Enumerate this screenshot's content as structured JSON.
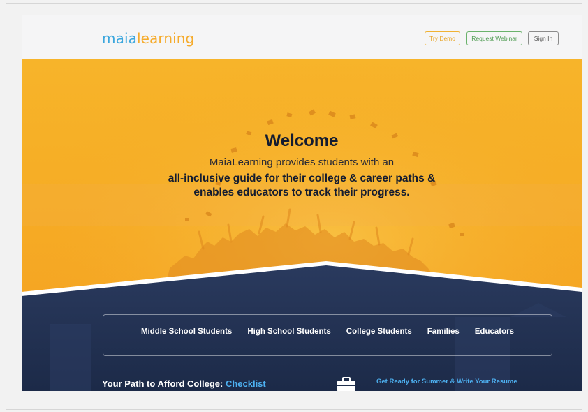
{
  "brand": {
    "logo_part1": "maia",
    "logo_part2": "learning"
  },
  "header": {
    "try_demo": "Try Demo",
    "request_webinar": "Request Webinar",
    "sign_in": "Sign In"
  },
  "hero": {
    "title": "Welcome",
    "line1": "MaiaLearning provides students with an",
    "line2": "all-inclusive guide for their college & career paths &",
    "line3": "enables educators to track their progress."
  },
  "audiences": [
    "Middle School Students",
    "High School Students",
    "College Students",
    "Families",
    "Educators"
  ],
  "promos": {
    "left_prefix": "Your Path to Afford College: ",
    "left_link": "Checklist",
    "right_title": "Get Ready for Summer & Write Your Resume"
  },
  "colors": {
    "accent_orange": "#f5a623",
    "navy": "#1f2e4d",
    "link_blue": "#4db0f0",
    "logo_blue": "#3aa6dd",
    "logo_orange": "#f5ab2c"
  },
  "icons": {
    "promo_icon": "briefcase-icon"
  }
}
